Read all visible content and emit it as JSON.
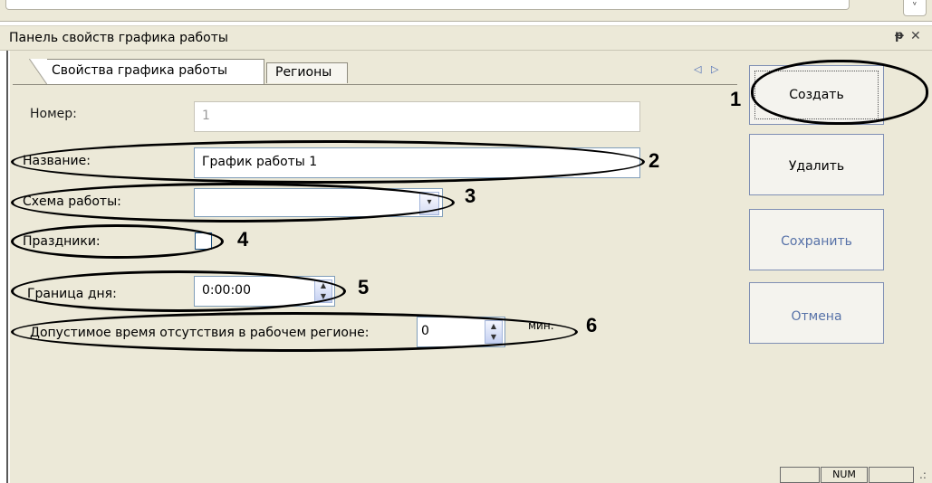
{
  "panel": {
    "title": "Панель свойств графика работы",
    "pin_glyph": "ᵽ",
    "close_glyph": "✕"
  },
  "tabs": [
    {
      "label": "Свойства графика работы",
      "active": true
    },
    {
      "label": "Регионы",
      "active": false
    }
  ],
  "tab_nav": {
    "left": "◁",
    "right": "▷"
  },
  "form": {
    "number": {
      "label": "Номер:",
      "value": "1"
    },
    "name": {
      "label": "Название:",
      "value": "График работы 1"
    },
    "schema": {
      "label": "Схема работы:",
      "value": "",
      "dropdown_glyph": "▾"
    },
    "holidays": {
      "label": "Праздники:",
      "checked": false
    },
    "day_border": {
      "label": "Граница дня:",
      "value": "0:00:00"
    },
    "absence": {
      "label": "Допустимое время отсутствия в рабочем регионе:",
      "value": "0",
      "unit": "мин."
    }
  },
  "spin_glyphs": {
    "up": "▲",
    "down": "▼"
  },
  "buttons": {
    "create": "Создать",
    "delete": "Удалить",
    "save": "Сохранить",
    "cancel": "Отмена"
  },
  "annotations": [
    "1",
    "2",
    "3",
    "4",
    "5",
    "6"
  ],
  "status_bar": {
    "cell1": "",
    "num": "NUM",
    "cell3": "",
    "grip": ".:"
  },
  "colors": {
    "panel_bg": "#ece9d8",
    "disabled_text": "#5772a8",
    "field_border": "#7f9db9"
  }
}
